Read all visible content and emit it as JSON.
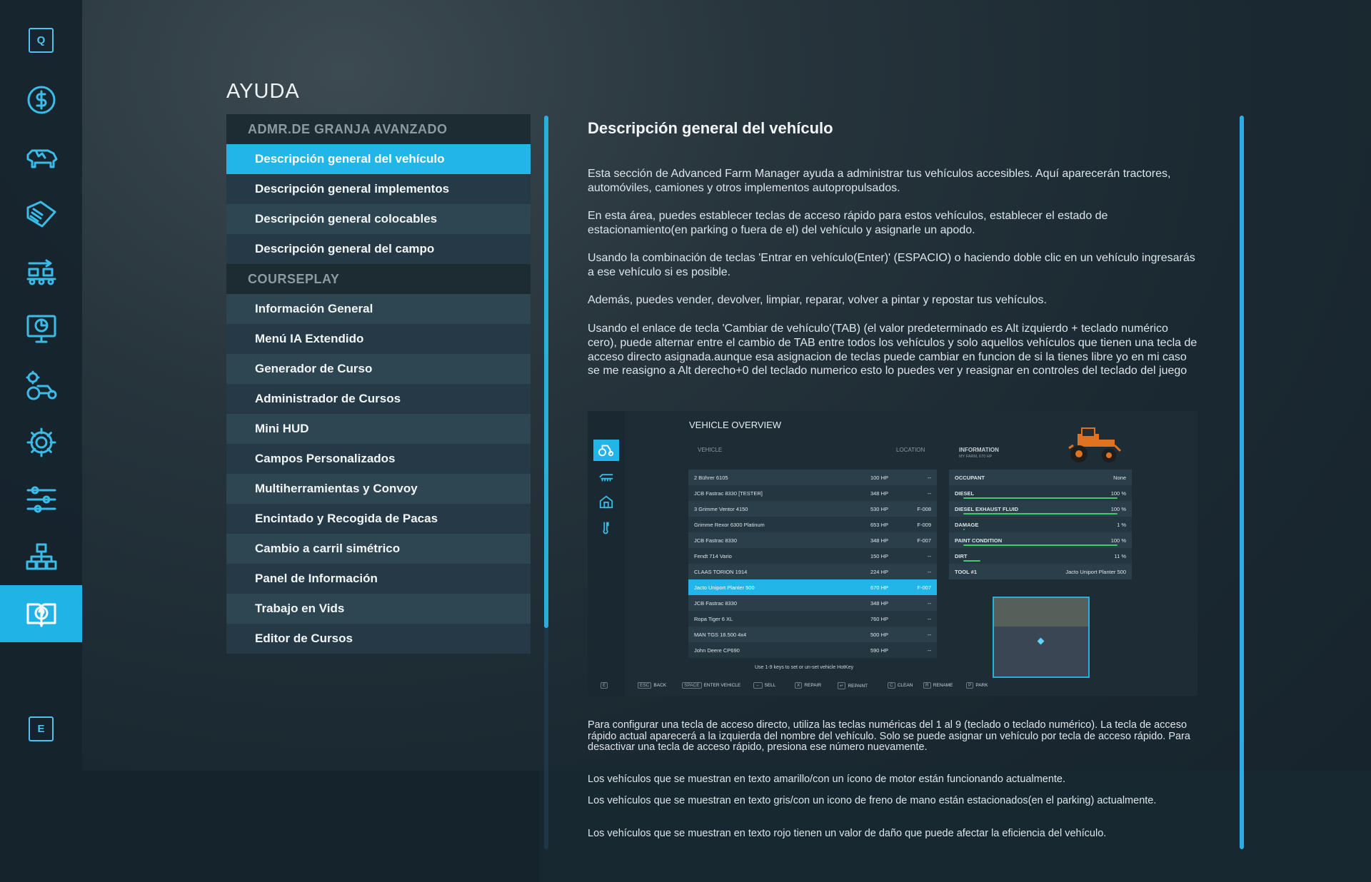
{
  "sidebar": {
    "top_key": "Q",
    "bottom_key": "E",
    "icons": [
      "finance-icon",
      "animals-icon",
      "contracts-icon",
      "production-icon",
      "statistics-icon",
      "vehicles-icon",
      "settings-icon",
      "controls-icon",
      "structure-icon",
      "help-icon"
    ]
  },
  "page_title": "AYUDA",
  "list": {
    "categories": [
      {
        "label": "ADMR.DE GRANJA AVANZADO",
        "items": [
          "Descripción general del vehículo",
          "Descripción general implementos",
          "Descripción general colocables",
          "Descripción general del campo"
        ]
      },
      {
        "label": "COURSEPLAY",
        "items": [
          "Información General",
          "Menú IA Extendido",
          "Generador de Curso",
          "Administrador de Cursos",
          "Mini HUD",
          "Campos Personalizados",
          "Multiherramientas y Convoy",
          "Encintado y Recogida de Pacas",
          "Cambio a carril simétrico",
          "Panel de Información",
          "Trabajo en Vids",
          "Editor de Cursos"
        ]
      }
    ],
    "selected": "Descripción general del vehículo"
  },
  "content": {
    "title": "Descripción general del vehículo",
    "paragraphs": [
      "Esta sección de Advanced Farm Manager ayuda a administrar tus vehículos accesibles. Aquí aparecerán tractores, automóviles, camiones y otros implementos autopropulsados.",
      "En esta área, puedes establecer teclas de acceso rápido para estos vehículos, establecer el estado de estacionamiento(en parking o fuera de el) del vehículo y asignarle un apodo.",
      "Usando la combinación de teclas 'Entrar en vehículo(Enter)' (ESPACIO) o haciendo doble clic en un vehículo ingresarás a ese vehículo si es posible.",
      "Además, puedes vender, devolver, limpiar, reparar, volver a pintar y repostar tus vehículos.",
      "Usando el enlace de tecla 'Cambiar de vehículo'(TAB) (el valor predeterminado es Alt izquierdo + teclado numérico cero), puede alternar entre el cambio de TAB entre todos los vehículos y solo aquellos vehículos que tienen una tecla de acceso directo asignada.aunque esa asignacion de teclas puede cambiar en funcion de si la tienes libre yo en mi caso se me reasigno a Alt derecho+0 del teclado numerico esto lo puedes ver y reasignar en controles del teclado del juego"
    ],
    "after": [
      "Para configurar una tecla de acceso directo, utiliza las teclas numéricas del 1 al 9 (teclado o teclado numérico). La tecla de acceso rápido actual aparecerá a la izquierda del nombre del vehículo. Solo se puede asignar un vehículo por tecla de acceso rápido. Para desactivar una tecla de acceso rápido, presiona ese número nuevamente.",
      "Los vehículos que se muestran en texto amarillo/con un ícono de motor están funcionando actualmente.",
      "Los vehículos que se muestran en texto gris/con un icono de freno de mano están estacionados(en el parking) actualmente.",
      "Los vehículos que se muestran en texto rojo tienen un valor de daño que puede afectar la eficiencia del vehículo."
    ]
  },
  "shot": {
    "title": "VEHICLE OVERVIEW",
    "hdr_vehicle": "VEHICLE",
    "hdr_location": "LOCATION",
    "hdr_info": "INFORMATION",
    "hdr_info_sub": "MY FARM, 670 HP",
    "vehicles": [
      {
        "name": "2 Bührer 6105",
        "hp": "100 HP",
        "loc": "--"
      },
      {
        "name": "JCB Fastrac 8330 [TESTER]",
        "hp": "348 HP",
        "loc": "--"
      },
      {
        "name": "3 Grimme Ventor 4150",
        "hp": "530 HP",
        "loc": "F-008"
      },
      {
        "name": "Grimme Rexor 6300 Platinum",
        "hp": "653 HP",
        "loc": "F-009"
      },
      {
        "name": "JCB Fastrac 8330",
        "hp": "348 HP",
        "loc": "F-007"
      },
      {
        "name": "Fendt 714 Vario",
        "hp": "150 HP",
        "loc": "--"
      },
      {
        "name": "CLAAS TORION 1914",
        "hp": "224 HP",
        "loc": "--"
      },
      {
        "name": "Jacto Uniport Planter 500",
        "hp": "670 HP",
        "loc": "F-007"
      },
      {
        "name": "JCB Fastrac 8330",
        "hp": "348 HP",
        "loc": "--"
      },
      {
        "name": "Ropa Tiger 6 XL",
        "hp": "760 HP",
        "loc": "--"
      },
      {
        "name": "MAN TGS 18.500 4x4",
        "hp": "500 HP",
        "loc": "--"
      },
      {
        "name": "John Deere CP690",
        "hp": "590 HP",
        "loc": "--"
      }
    ],
    "selected_vehicle": "Jacto Uniport Planter 500",
    "info": [
      {
        "k": "OCCUPANT",
        "v": "None",
        "fill": null
      },
      {
        "k": "DIESEL",
        "v": "100 %",
        "fill": 1.0
      },
      {
        "k": "DIESEL EXHAUST FLUID",
        "v": "100 %",
        "fill": 1.0
      },
      {
        "k": "DAMAGE",
        "v": "1 %",
        "fill": 0.01
      },
      {
        "k": "PAINT CONDITION",
        "v": "100 %",
        "fill": 1.0
      },
      {
        "k": "DIRT",
        "v": "11 %",
        "fill": 0.11
      },
      {
        "k": "TOOL #1",
        "v": "Jacto Uniport Planter 500",
        "fill": null
      }
    ],
    "hint": "Use 1-9 keys to set or un-set vehicle HotKey",
    "keys": [
      {
        "cap": "E",
        "label": ""
      },
      {
        "cap": "ESC",
        "label": "BACK"
      },
      {
        "cap": "SPACE",
        "label": "ENTER VEHICLE"
      },
      {
        "cap": "←",
        "label": "SELL"
      },
      {
        "cap": "X",
        "label": "REPAIR"
      },
      {
        "cap": "↵",
        "label": "REPAINT"
      },
      {
        "cap": "C",
        "label": "CLEAN"
      },
      {
        "cap": "R",
        "label": "RENAME"
      },
      {
        "cap": "P",
        "label": "PARK"
      }
    ]
  },
  "colors": {
    "accent": "#22b5e8",
    "list_odd": "#2e4552",
    "list_even": "#253a46",
    "category_bg": "#1d2b33"
  }
}
